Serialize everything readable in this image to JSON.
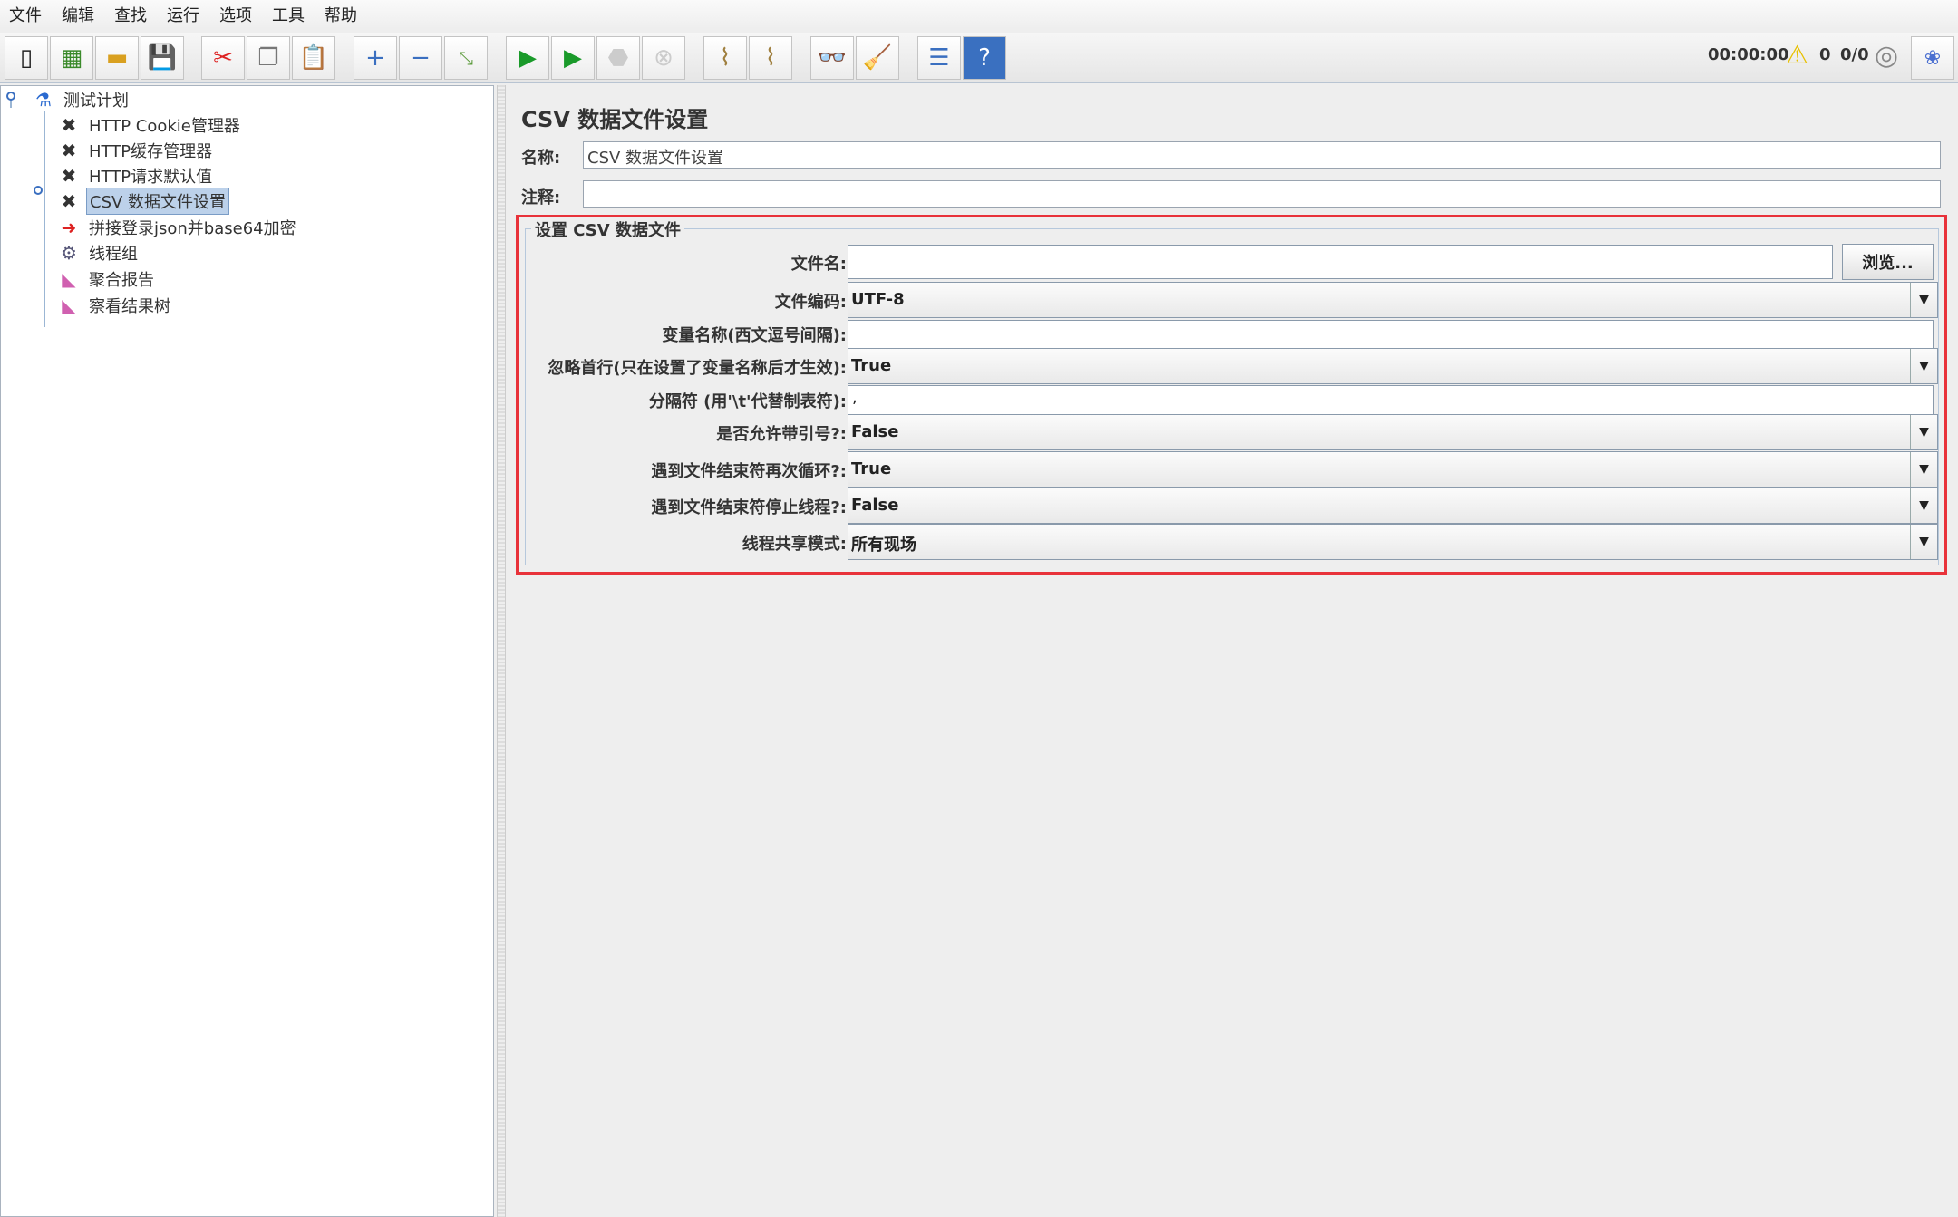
{
  "menu": [
    "文件",
    "编辑",
    "查找",
    "运行",
    "选项",
    "工具",
    "帮助"
  ],
  "toolbar": {
    "timer": "00:00:00",
    "warnings": "0",
    "threads": "0/0"
  },
  "tree": [
    {
      "label": "测试计划",
      "icon": "test-plan-icon"
    },
    {
      "label": "HTTP Cookie管理器",
      "icon": "wrench-icon"
    },
    {
      "label": "HTTP缓存管理器",
      "icon": "wrench-icon"
    },
    {
      "label": "HTTP请求默认值",
      "icon": "wrench-icon"
    },
    {
      "label": "CSV 数据文件设置",
      "icon": "wrench-icon",
      "selected": true
    },
    {
      "label": "拼接登录json并base64加密",
      "icon": "preprocessor-icon"
    },
    {
      "label": "线程组",
      "icon": "gear-icon"
    },
    {
      "label": "聚合报告",
      "icon": "chart-icon"
    },
    {
      "label": "察看结果树",
      "icon": "chart-icon"
    }
  ],
  "panel": {
    "title": "CSV 数据文件设置",
    "name_label": "名称:",
    "name_value": "CSV 数据文件设置",
    "comment_label": "注释:",
    "comment_value": "",
    "group_title": "设置 CSV 数据文件",
    "filename_label": "文件名:",
    "filename_value": "",
    "browse_label": "浏览...",
    "encoding_label": "文件编码:",
    "encoding_value": "UTF-8",
    "varnames_label": "变量名称(西文逗号间隔):",
    "varnames_value": "",
    "ignore_first_label": "忽略首行(只在设置了变量名称后才生效):",
    "ignore_first_value": "True",
    "delimiter_label": "分隔符 (用'\\t'代替制表符):",
    "delimiter_value": ",",
    "quoted_label": "是否允许带引号?:",
    "quoted_value": "False",
    "recycle_label": "遇到文件结束符再次循环?:",
    "recycle_value": "True",
    "stop_label": "遇到文件结束符停止线程?:",
    "stop_value": "False",
    "share_label": "线程共享模式:",
    "share_value": "所有现场"
  }
}
